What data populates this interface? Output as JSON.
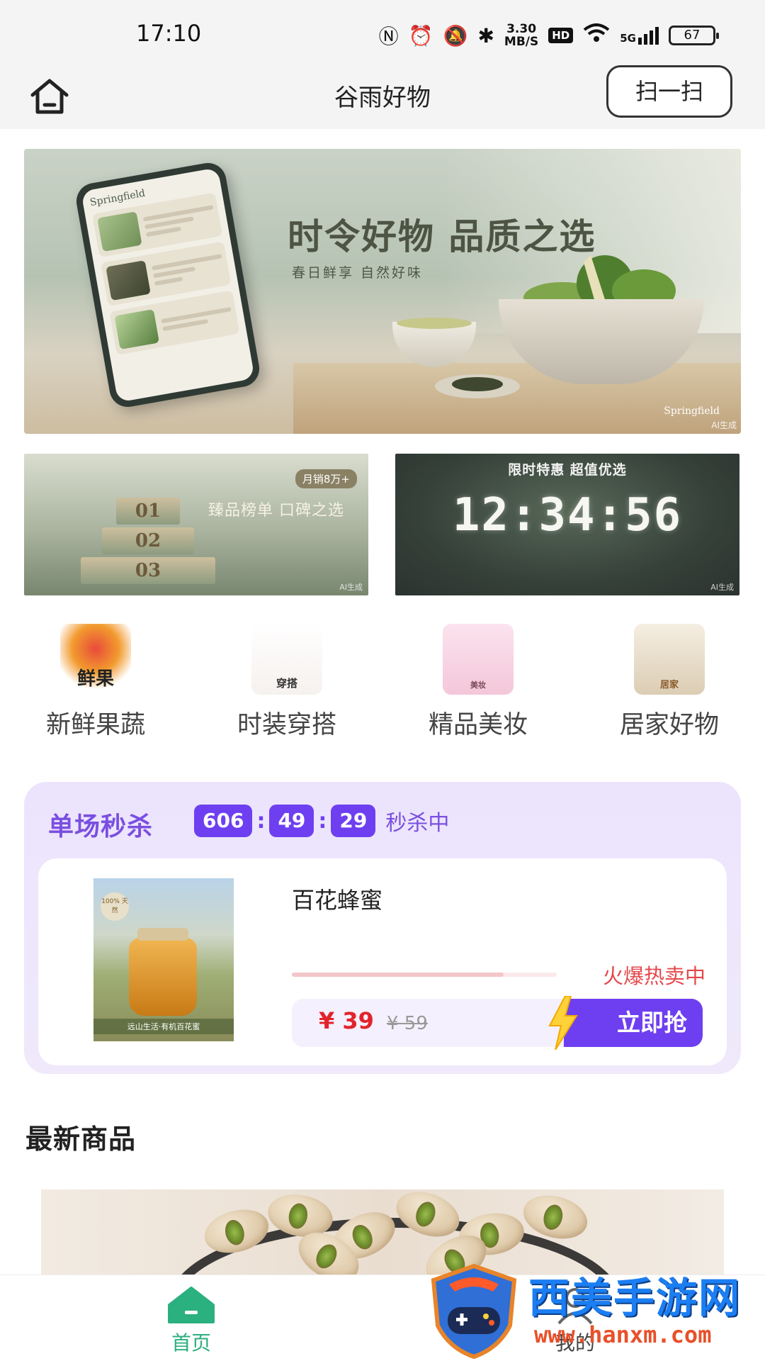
{
  "status_bar": {
    "time": "17:10",
    "speed_value": "3.30",
    "speed_unit": "MB/S",
    "hd": "HD",
    "network": "5G",
    "battery": "67"
  },
  "header": {
    "title": "谷雨好物",
    "scan_label": "扫一扫"
  },
  "hero_banner": {
    "heading": "时令好物 品质之选",
    "subheading": "春日鲜享  自然好味",
    "brand": "Springfield",
    "ai_tag": "AI生成"
  },
  "promo_left": {
    "badge": "月销8万+",
    "title": "臻品榜单 口碑之选",
    "ranks": [
      "01",
      "02",
      "03"
    ]
  },
  "promo_right": {
    "title": "限时特惠 超值优选",
    "countdown": "12:34:56"
  },
  "categories": [
    {
      "label": "新鲜果蔬",
      "icon_text": "鲜果"
    },
    {
      "label": "时装穿搭",
      "icon_text": "穿搭"
    },
    {
      "label": "精品美妆",
      "icon_text": "美妆"
    },
    {
      "label": "居家好物",
      "icon_text": "居家"
    }
  ],
  "flash_sale": {
    "title": "单场秒杀",
    "hours": "606",
    "minutes": "49",
    "seconds": "29",
    "status": "秒杀中",
    "product": {
      "name": "百花蜂蜜",
      "image_caption": "远山生活·有机百花蜜",
      "seal_text": "100% 天然",
      "hot_label": "火爆热卖中",
      "progress_percent": 80,
      "price": "¥ 39",
      "original_price": "¥ 59",
      "buy_label": "立即抢"
    }
  },
  "latest": {
    "title": "最新商品"
  },
  "bottom_nav": {
    "home_label": "首页",
    "mine_label": "我的",
    "active_color": "#2bb07f"
  },
  "watermark": {
    "text": "西美手游网",
    "url": "www.hanxm.com"
  }
}
